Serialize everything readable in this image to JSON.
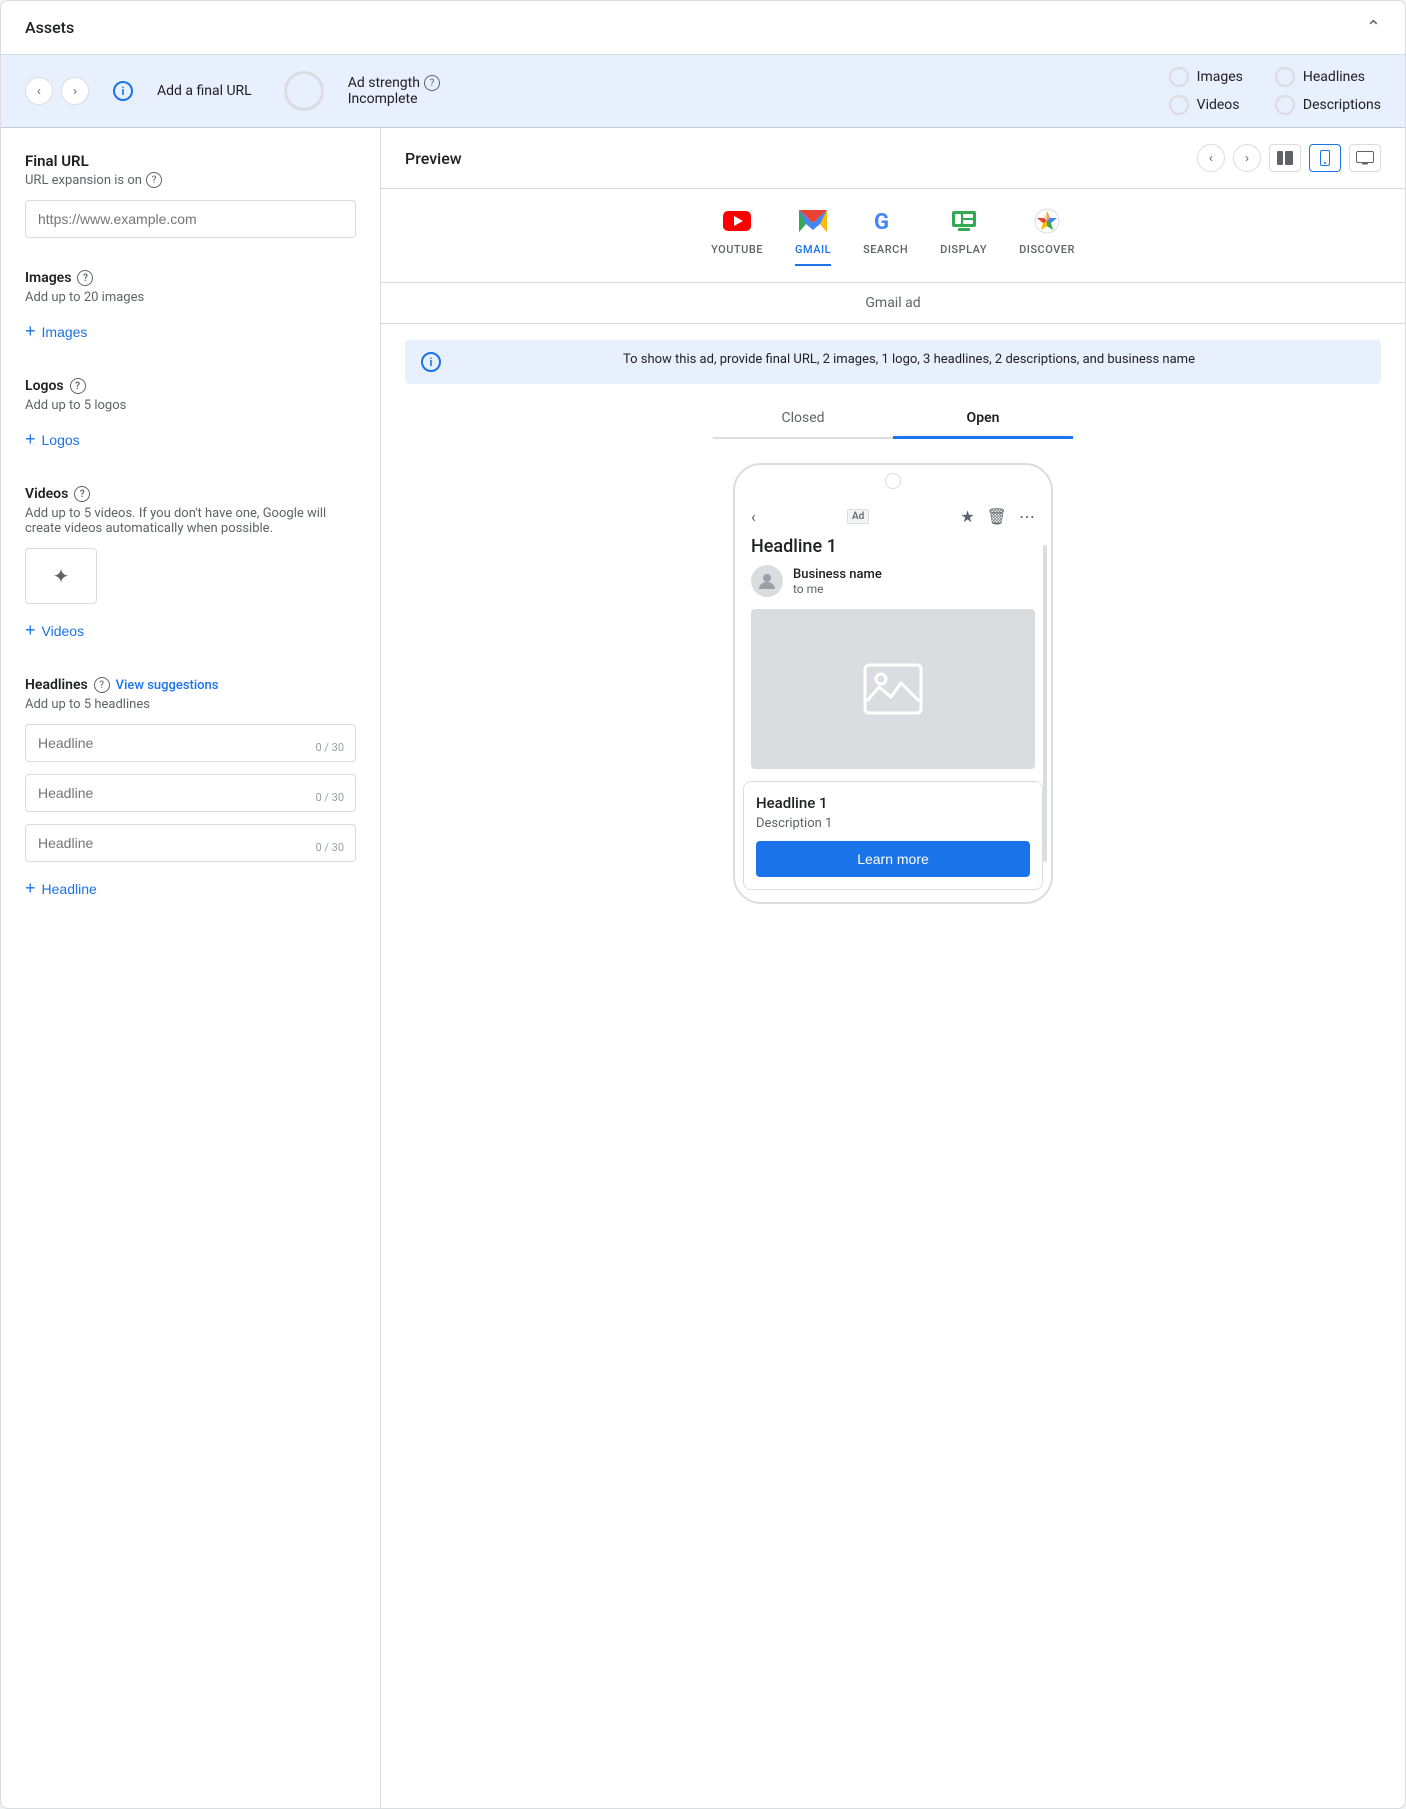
{
  "header": {
    "title": "Assets",
    "collapse_label": "collapse"
  },
  "topbar": {
    "final_url_label": "Add a final URL",
    "ad_strength_label": "Ad strength",
    "ad_strength_status": "Incomplete",
    "indicators": [
      {
        "label": "Images"
      },
      {
        "label": "Videos"
      },
      {
        "label": "Headlines"
      },
      {
        "label": "Descriptions"
      }
    ]
  },
  "left_panel": {
    "final_url": {
      "label": "Final URL",
      "sublabel": "URL expansion is on",
      "placeholder": "https://www.example.com"
    },
    "images": {
      "title": "Images",
      "description": "Add up to 20 images",
      "add_label": "Images"
    },
    "logos": {
      "title": "Logos",
      "description": "Add up to 5 logos",
      "add_label": "Logos"
    },
    "videos": {
      "title": "Videos",
      "description": "Add up to 5 videos. If you don't have one, Google will create videos automatically when possible.",
      "add_label": "Videos"
    },
    "headlines": {
      "title": "Headlines",
      "view_suggestions": "View suggestions",
      "description": "Add up to 5 headlines",
      "inputs": [
        {
          "placeholder": "Headline",
          "count": "0 / 30"
        },
        {
          "placeholder": "Headline",
          "count": "0 / 30"
        },
        {
          "placeholder": "Headline",
          "count": "0 / 30"
        }
      ],
      "add_label": "Headline"
    }
  },
  "right_panel": {
    "preview_title": "Preview",
    "platform_tabs": [
      {
        "label": "YOUTUBE",
        "active": false
      },
      {
        "label": "GMAIL",
        "active": true
      },
      {
        "label": "SEARCH",
        "active": false
      },
      {
        "label": "DISPLAY",
        "active": false
      },
      {
        "label": "DISCOVER",
        "active": false
      }
    ],
    "gmail_ad_label": "Gmail ad",
    "info_banner": "To show this ad, provide final URL, 2 images, 1 logo, 3 headlines, 2 descriptions, and business name",
    "ad_tabs": [
      {
        "label": "Closed",
        "active": false
      },
      {
        "label": "Open",
        "active": true
      }
    ],
    "phone": {
      "headline": "Headline 1",
      "sender_name": "Business name",
      "sender_to": "to me",
      "ad_badge": "Ad",
      "ad_card": {
        "headline": "Headline 1",
        "description": "Description 1",
        "learn_more": "Learn more"
      }
    }
  }
}
